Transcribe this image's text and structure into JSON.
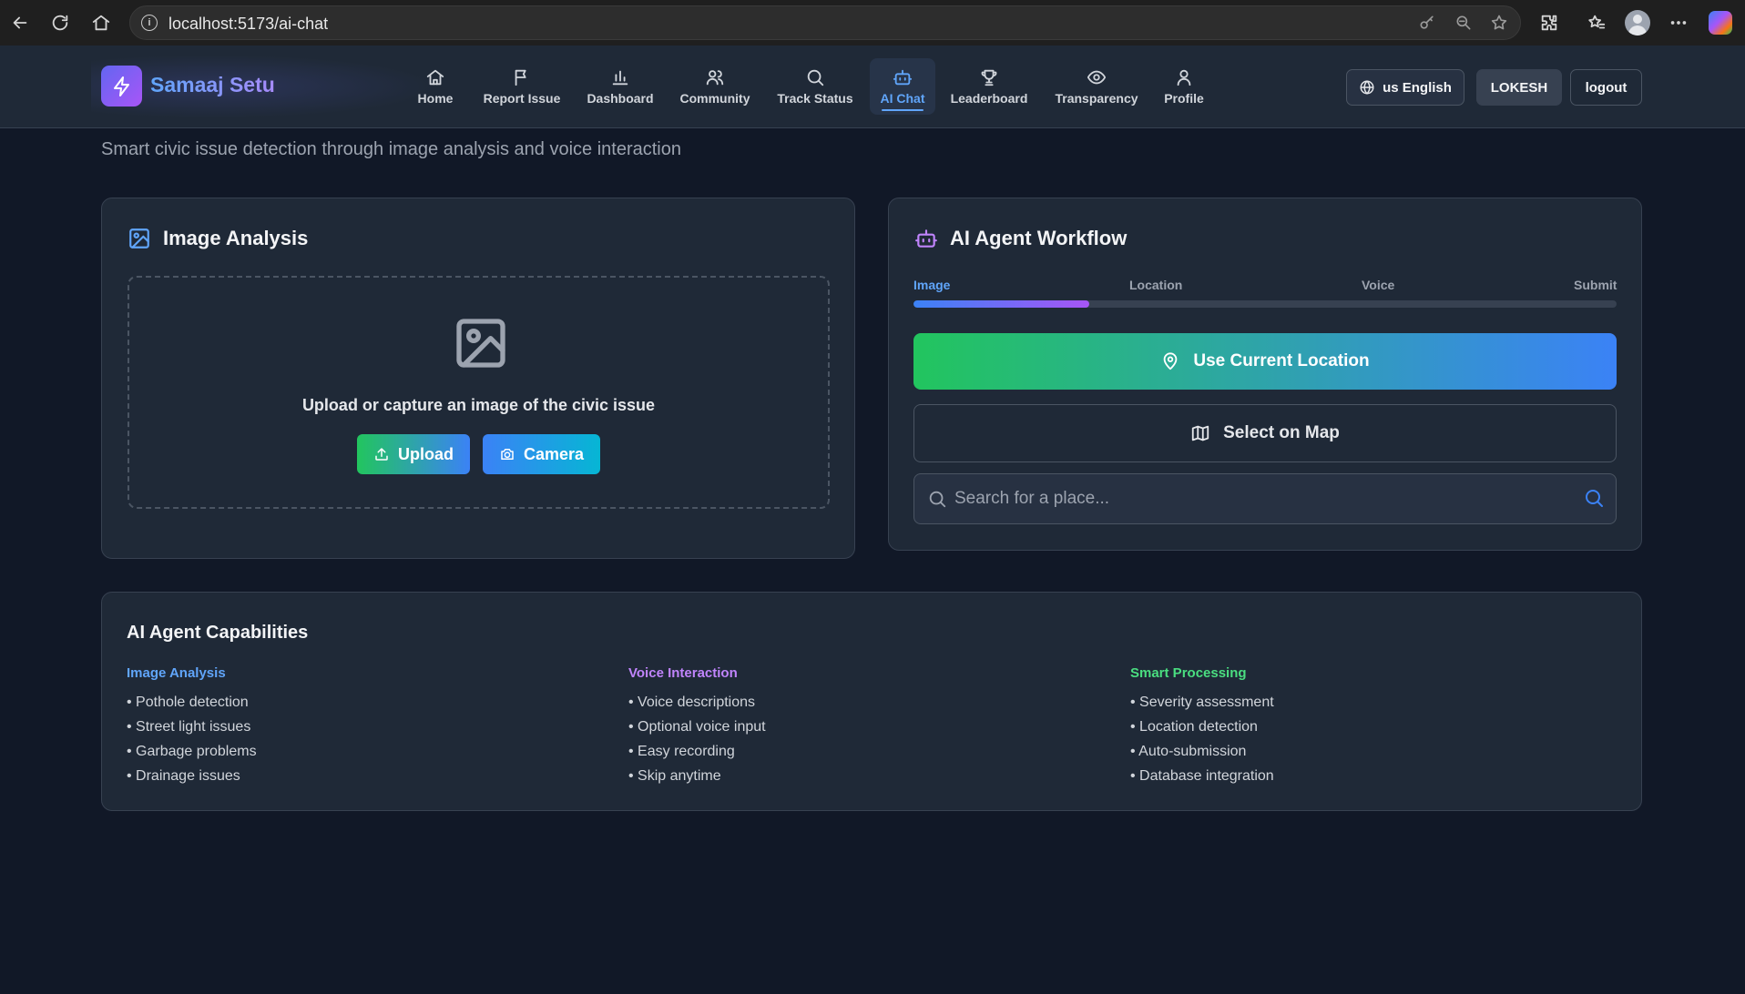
{
  "browser": {
    "url": "localhost:5173/ai-chat",
    "info_glyph": "i"
  },
  "app": {
    "name": "Samaaj Setu",
    "nav": [
      {
        "label": "Home",
        "icon": "home-icon"
      },
      {
        "label": "Report Issue",
        "icon": "flag-icon"
      },
      {
        "label": "Dashboard",
        "icon": "bar-chart-icon"
      },
      {
        "label": "Community",
        "icon": "users-icon"
      },
      {
        "label": "Track Status",
        "icon": "search-icon"
      },
      {
        "label": "AI Chat",
        "icon": "bot-icon",
        "active": true
      },
      {
        "label": "Leaderboard",
        "icon": "trophy-icon"
      },
      {
        "label": "Transparency",
        "icon": "eye-icon"
      },
      {
        "label": "Profile",
        "icon": "user-icon"
      }
    ],
    "language_label": "us English",
    "user_label": "LOKESH",
    "logout_label": "logout"
  },
  "page": {
    "subtitle": "Smart civic issue detection through image analysis and voice interaction"
  },
  "image_analysis": {
    "title": "Image Analysis",
    "prompt": "Upload or capture an image of the civic issue",
    "upload_label": "Upload",
    "camera_label": "Camera"
  },
  "workflow": {
    "title": "AI Agent Workflow",
    "steps": [
      "Image",
      "Location",
      "Voice",
      "Submit"
    ],
    "active_step": "Image",
    "progress_fraction": 0.25,
    "use_location_label": "Use Current Location",
    "select_map_label": "Select on Map",
    "search_placeholder": "Search for a place...",
    "search_value": ""
  },
  "capabilities": {
    "title": "AI Agent Capabilities",
    "columns": [
      {
        "heading": "Image Analysis",
        "color": "#60a5fa",
        "items": [
          "• Pothole detection",
          "• Street light issues",
          "• Garbage problems",
          "• Drainage issues"
        ]
      },
      {
        "heading": "Voice Interaction",
        "color": "#c084fc",
        "items": [
          "• Voice descriptions",
          "• Optional voice input",
          "• Easy recording",
          "• Skip anytime"
        ]
      },
      {
        "heading": "Smart Processing",
        "color": "#4ade80",
        "items": [
          "• Severity assessment",
          "• Location detection",
          "• Auto-submission",
          "• Database integration"
        ]
      }
    ]
  },
  "colors": {
    "page_bg": "#111827",
    "card_bg": "#1f2937",
    "accent_blue": "#60a5fa",
    "accent_purple": "#a855f7",
    "accent_green": "#22c55e"
  }
}
